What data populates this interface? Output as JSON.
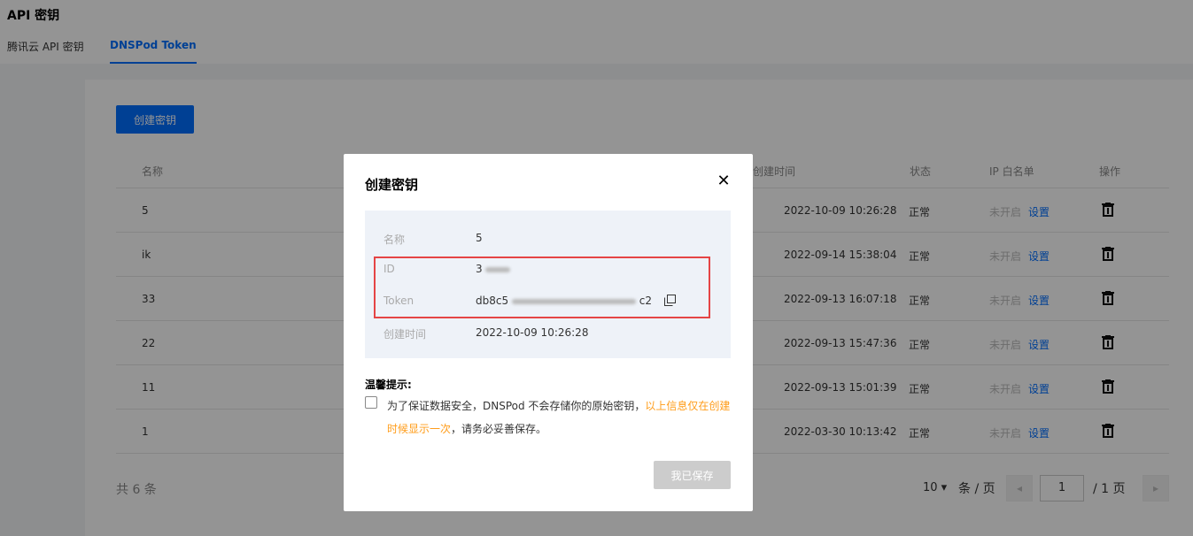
{
  "header": {
    "title": "API 密钥",
    "tabs": [
      {
        "label": "腾讯云 API 密钥"
      },
      {
        "label": "DNSPod Token"
      }
    ]
  },
  "toolbar": {
    "create_label": "创建密钥"
  },
  "table": {
    "columns": [
      "名称",
      "创建时间",
      "状态",
      "IP 白名单",
      "操作"
    ],
    "rows": [
      {
        "name": "5",
        "created": "2022-10-09 10:26:28",
        "status": "正常",
        "ip_state": "未开启",
        "ip_action": "设置"
      },
      {
        "name": "ik",
        "created": "2022-09-14 15:38:04",
        "status": "正常",
        "ip_state": "未开启",
        "ip_action": "设置"
      },
      {
        "name": "33",
        "created": "2022-09-13 16:07:18",
        "status": "正常",
        "ip_state": "未开启",
        "ip_action": "设置"
      },
      {
        "name": "22",
        "created": "2022-09-13 15:47:36",
        "status": "正常",
        "ip_state": "未开启",
        "ip_action": "设置"
      },
      {
        "name": "11",
        "created": "2022-09-13 15:01:39",
        "status": "正常",
        "ip_state": "未开启",
        "ip_action": "设置"
      },
      {
        "name": "1",
        "created": "2022-03-30 10:13:42",
        "status": "正常",
        "ip_state": "未开启",
        "ip_action": "设置"
      }
    ]
  },
  "footer": {
    "total": "共 6 条",
    "page_size": "10 ▾",
    "per_page": "条 / 页",
    "current_page": "1",
    "total_pages": "/ 1 页",
    "prev": "◂",
    "next": "▸"
  },
  "modal": {
    "title": "创建密钥",
    "close": "✕",
    "fields": {
      "name_label": "名称",
      "name_value": "5",
      "id_label": "ID",
      "id_value": "3",
      "token_label": "Token",
      "token_value_start": "db8c5",
      "token_value_end": "c2",
      "created_label": "创建时间",
      "created_value": "2022-10-09 10:26:28"
    },
    "tips_title": "温馨提示:",
    "tips_text": "为了保证数据安全，DNSPod 不会存储你的原始密钥，",
    "tips_warn": "以上信息仅在创建时候显示一次",
    "tips_tail": "，请务必妥善保存。",
    "save_label": "我已保存"
  },
  "colors": {
    "accent": "#006eff",
    "warning": "#ff9c19",
    "highlight_border": "#e54545"
  }
}
